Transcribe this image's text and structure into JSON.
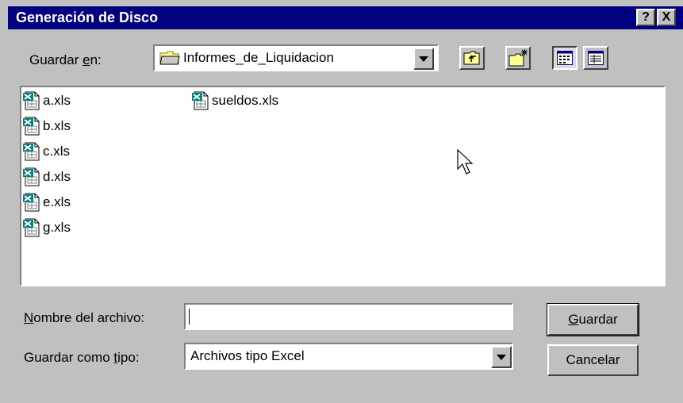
{
  "window": {
    "title": "Generación de Disco"
  },
  "titlebar_buttons": {
    "help": "?",
    "close": "X"
  },
  "save_in": {
    "label_prefix": "Guardar ",
    "label_accel": "e",
    "label_suffix": "n:",
    "folder": "Informes_de_Liquidacion"
  },
  "toolbar": {
    "icons": [
      "folder-up-icon",
      "new-folder-icon",
      "list-view-icon",
      "details-view-icon"
    ]
  },
  "files": [
    {
      "name": "a.xls"
    },
    {
      "name": "b.xls"
    },
    {
      "name": "c.xls"
    },
    {
      "name": "d.xls"
    },
    {
      "name": "e.xls"
    },
    {
      "name": "g.xls"
    },
    {
      "name": "sueldos.xls"
    }
  ],
  "filename": {
    "label_accel": "N",
    "label_rest": "ombre del archivo:",
    "value": ""
  },
  "filetype": {
    "label_prefix": "Guardar como ",
    "label_accel": "t",
    "label_suffix": "ipo:",
    "value": "Archivos tipo Excel"
  },
  "buttons": {
    "save_accel": "G",
    "save_rest": "uardar",
    "cancel": "Cancelar"
  }
}
